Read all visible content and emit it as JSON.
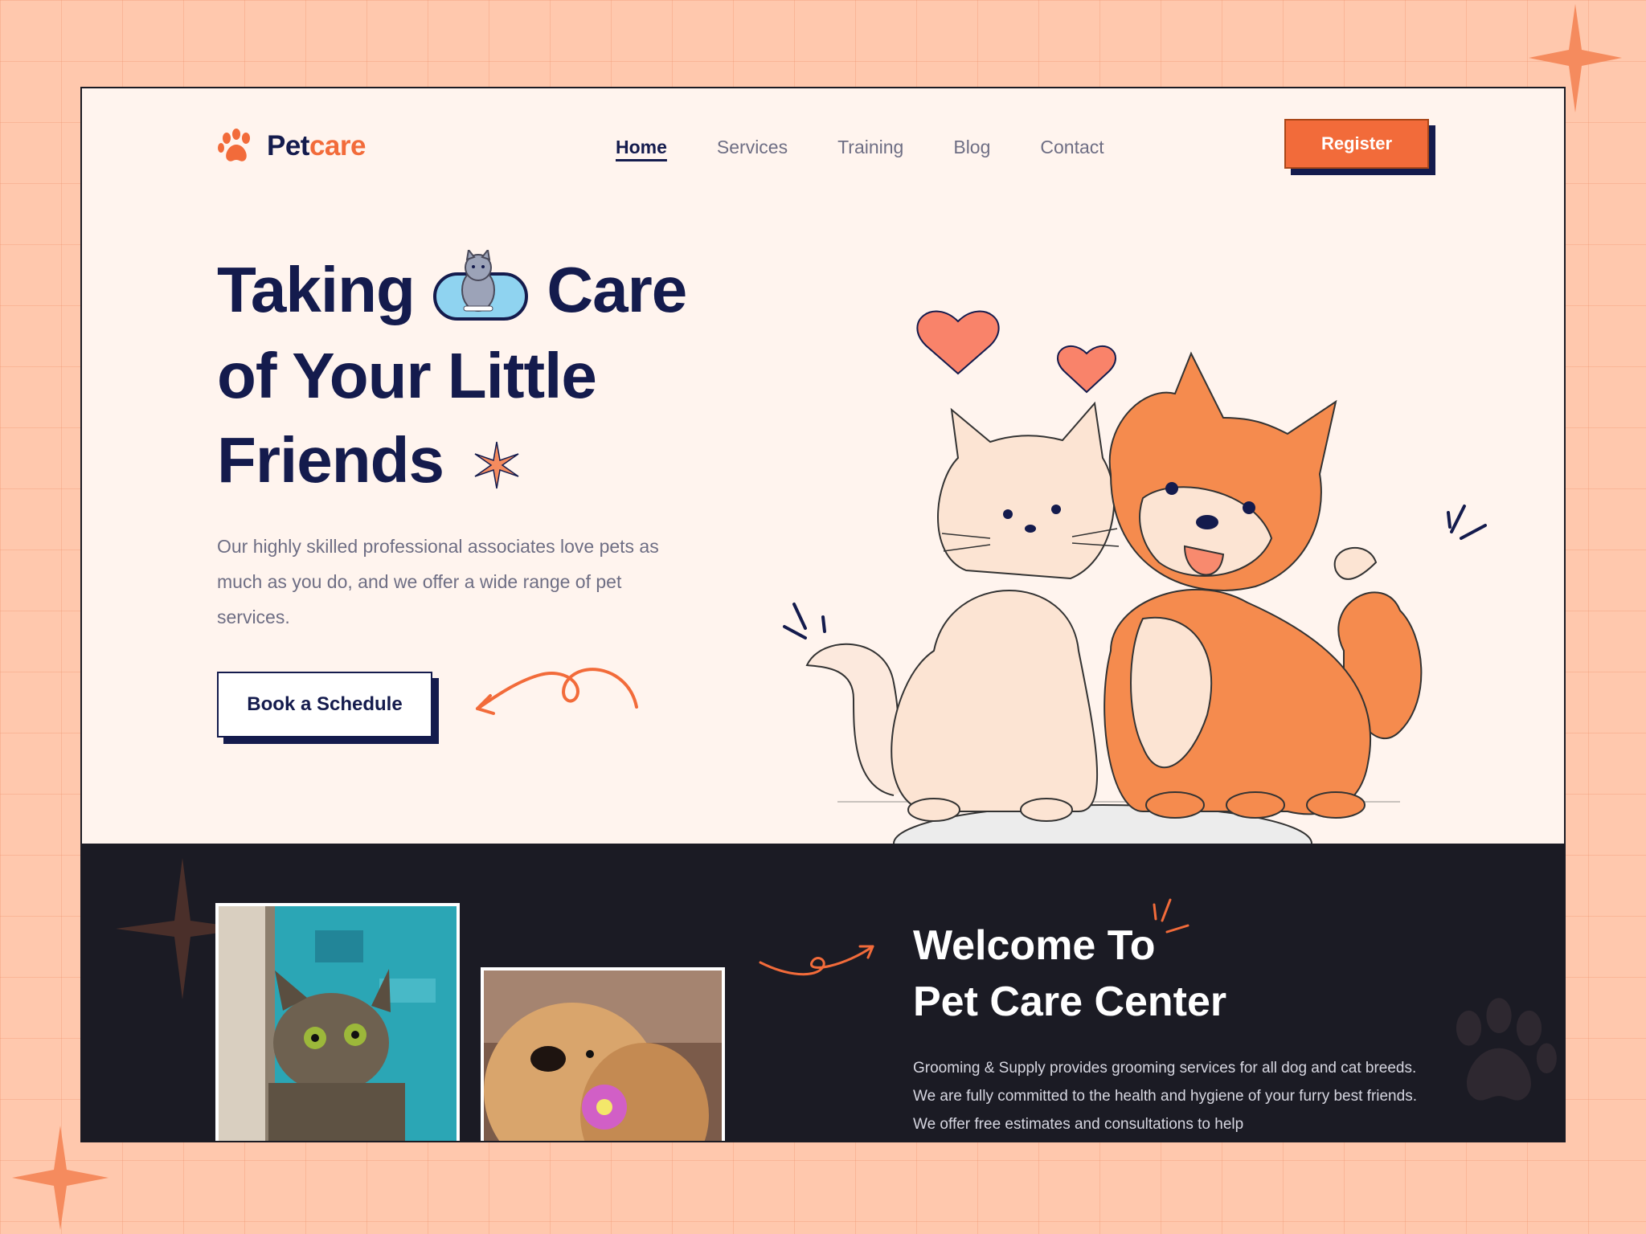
{
  "brand": {
    "name_part1": "Pet",
    "name_part2": "care",
    "icon": "paw-icon"
  },
  "nav": {
    "items": [
      {
        "label": "Home",
        "active": true
      },
      {
        "label": "Services",
        "active": false
      },
      {
        "label": "Training",
        "active": false
      },
      {
        "label": "Blog",
        "active": false
      },
      {
        "label": "Contact",
        "active": false
      }
    ],
    "register_label": "Register"
  },
  "hero": {
    "title_line1_a": "Taking",
    "title_line1_b": "Care",
    "title_line2": "of Your Little",
    "title_line3": "Friends",
    "description": "Our highly skilled professional associates love pets as much as you do, and we offer a wide range of pet services.",
    "cta_label": "Book a Schedule"
  },
  "welcome": {
    "title_line1": "Welcome To",
    "title_line2": "Pet Care Center",
    "description": "Grooming & Supply provides grooming services for all dog and cat breeds. We are fully committed to the health and hygiene of your furry best friends. We offer free estimates and consultations to help"
  },
  "colors": {
    "accent": "#F26B3A",
    "navy": "#141B4D",
    "background": "#FFC8AD",
    "hero_bg": "#FFF4EE",
    "dark_bg": "#1B1B24"
  }
}
